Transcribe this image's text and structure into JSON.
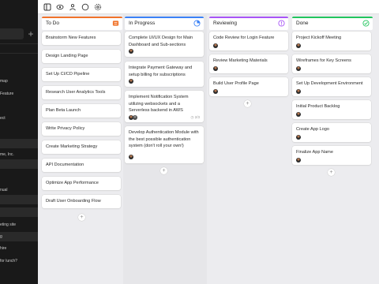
{
  "sidebar": {
    "items": [
      {
        "label": "map"
      },
      {
        "label": "Feature"
      },
      {
        "label": "ect"
      },
      {
        "label": "me, Inc."
      },
      {
        "label": "nual"
      },
      {
        "label": "eting site"
      },
      {
        "label": "g"
      },
      {
        "label": "hire"
      },
      {
        "label": "for lunch?"
      }
    ]
  },
  "topbar": {
    "icons": [
      "sidebar-toggle-icon",
      "eye-icon",
      "users-icon",
      "circle-icon",
      "settings-icon"
    ]
  },
  "board": {
    "columns": [
      {
        "title": "To Do",
        "status_icon": "todo-status-icon",
        "accent": "#f0732b",
        "cards": [
          {
            "title": "Brainstorm New Features"
          },
          {
            "title": "Design Landing Page"
          },
          {
            "title": "Set Up CI/CD Pipeline"
          },
          {
            "title": "Research User Analytics Tools"
          },
          {
            "title": "Plan Beta Launch"
          },
          {
            "title": "Write Privacy Policy"
          },
          {
            "title": "Create Marketing Strategy"
          },
          {
            "title": "API Documentation"
          },
          {
            "title": "Optimize App Performance"
          },
          {
            "title": "Draft User Onboarding Flow"
          }
        ]
      },
      {
        "title": "In Progress",
        "status_icon": "in-progress-status-icon",
        "accent": "#3b82f6",
        "cards": [
          {
            "title": "Complete UI/UX Design for Main Dashboard and Sub-sections"
          },
          {
            "title": "Integrate Payment Gateway and setup billing for subscriptions"
          },
          {
            "title": "Implement Notification System utilizing websockets and a Serverless backend in AWS",
            "meta": "2/3"
          },
          {
            "title": "Develop Authentication Module with the best possible authentication system (don't roll your own!)"
          }
        ]
      },
      {
        "title": "Reviewing",
        "status_icon": "reviewing-status-icon",
        "accent": "#a855f7",
        "cards": [
          {
            "title": "Code Review for Login Feature"
          },
          {
            "title": "Review Marketing Materials"
          },
          {
            "title": "Build User Profile Page"
          }
        ]
      },
      {
        "title": "Done",
        "status_icon": "done-status-icon",
        "accent": "#22c55e",
        "cards": [
          {
            "title": "Project Kickoff Meeting"
          },
          {
            "title": "Wireframes for Key Screens"
          },
          {
            "title": "Set Up Development Environment"
          },
          {
            "title": "Initial Product Backlog"
          },
          {
            "title": "Create App Logo"
          },
          {
            "title": "Finalize App Name"
          }
        ]
      }
    ]
  }
}
